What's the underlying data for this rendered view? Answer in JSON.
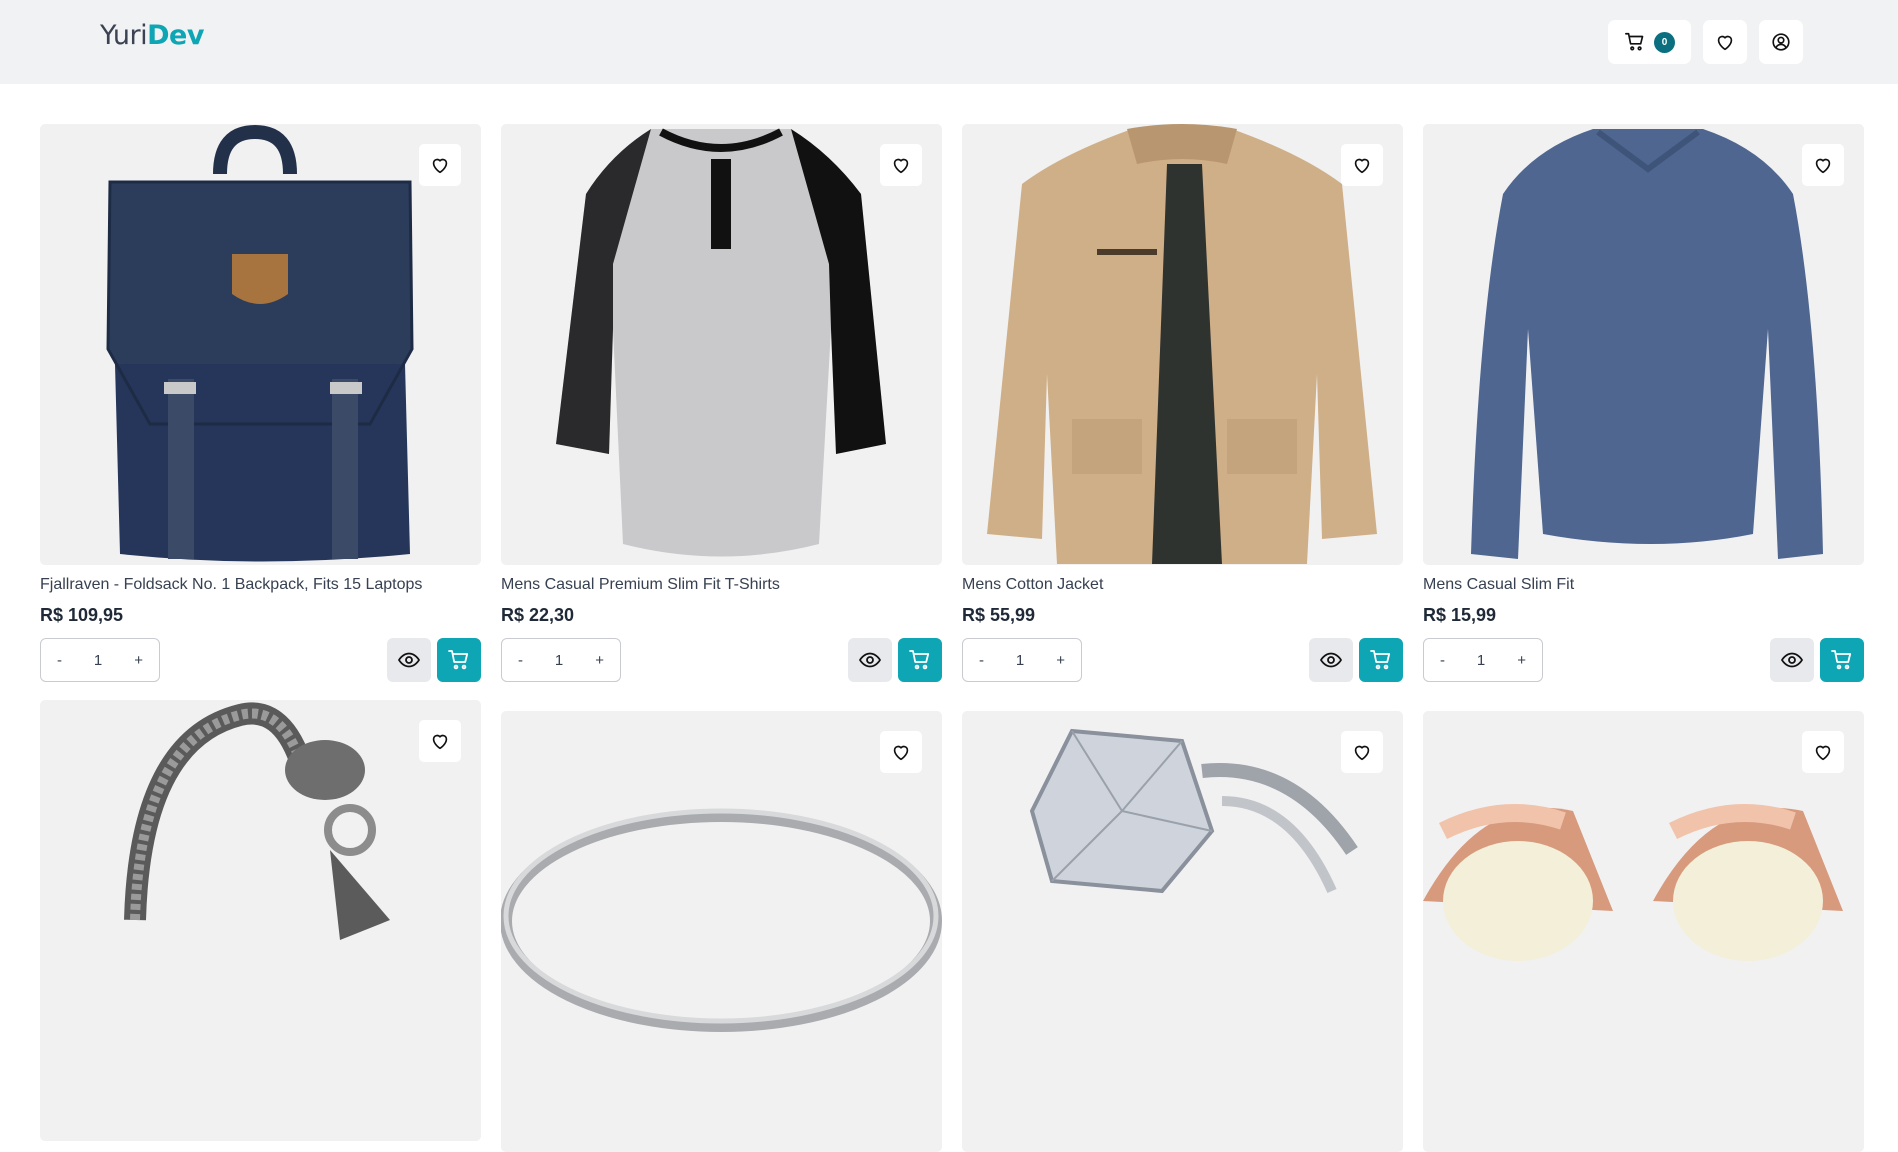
{
  "header": {
    "logo_part1": "Yuri",
    "logo_part2": "Dev",
    "cart_count": "0",
    "cart_icon": "cart-icon",
    "wishlist_icon": "heart-icon",
    "user_icon": "user-circle-icon"
  },
  "colors": {
    "accent": "#0ea5b4",
    "badge": "#0b6f7f",
    "header_bg": "#f1f2f4",
    "card_bg": "#f1f1f2"
  },
  "products": [
    {
      "title": "Fjallraven - Foldsack No. 1 Backpack, Fits 15 Laptops",
      "price": "R$ 109,95",
      "qty": "1",
      "minus": "-",
      "plus": "+"
    },
    {
      "title": "Mens Casual Premium Slim Fit T-Shirts",
      "price": "R$ 22,30",
      "qty": "1",
      "minus": "-",
      "plus": "+"
    },
    {
      "title": "Mens Cotton Jacket",
      "price": "R$ 55,99",
      "qty": "1",
      "minus": "-",
      "plus": "+"
    },
    {
      "title": "Mens Casual Slim Fit",
      "price": "R$ 15,99",
      "qty": "1",
      "minus": "-",
      "plus": "+"
    },
    {
      "title": "",
      "price": ""
    },
    {
      "title": "",
      "price": ""
    },
    {
      "title": "",
      "price": ""
    },
    {
      "title": "",
      "price": ""
    }
  ]
}
